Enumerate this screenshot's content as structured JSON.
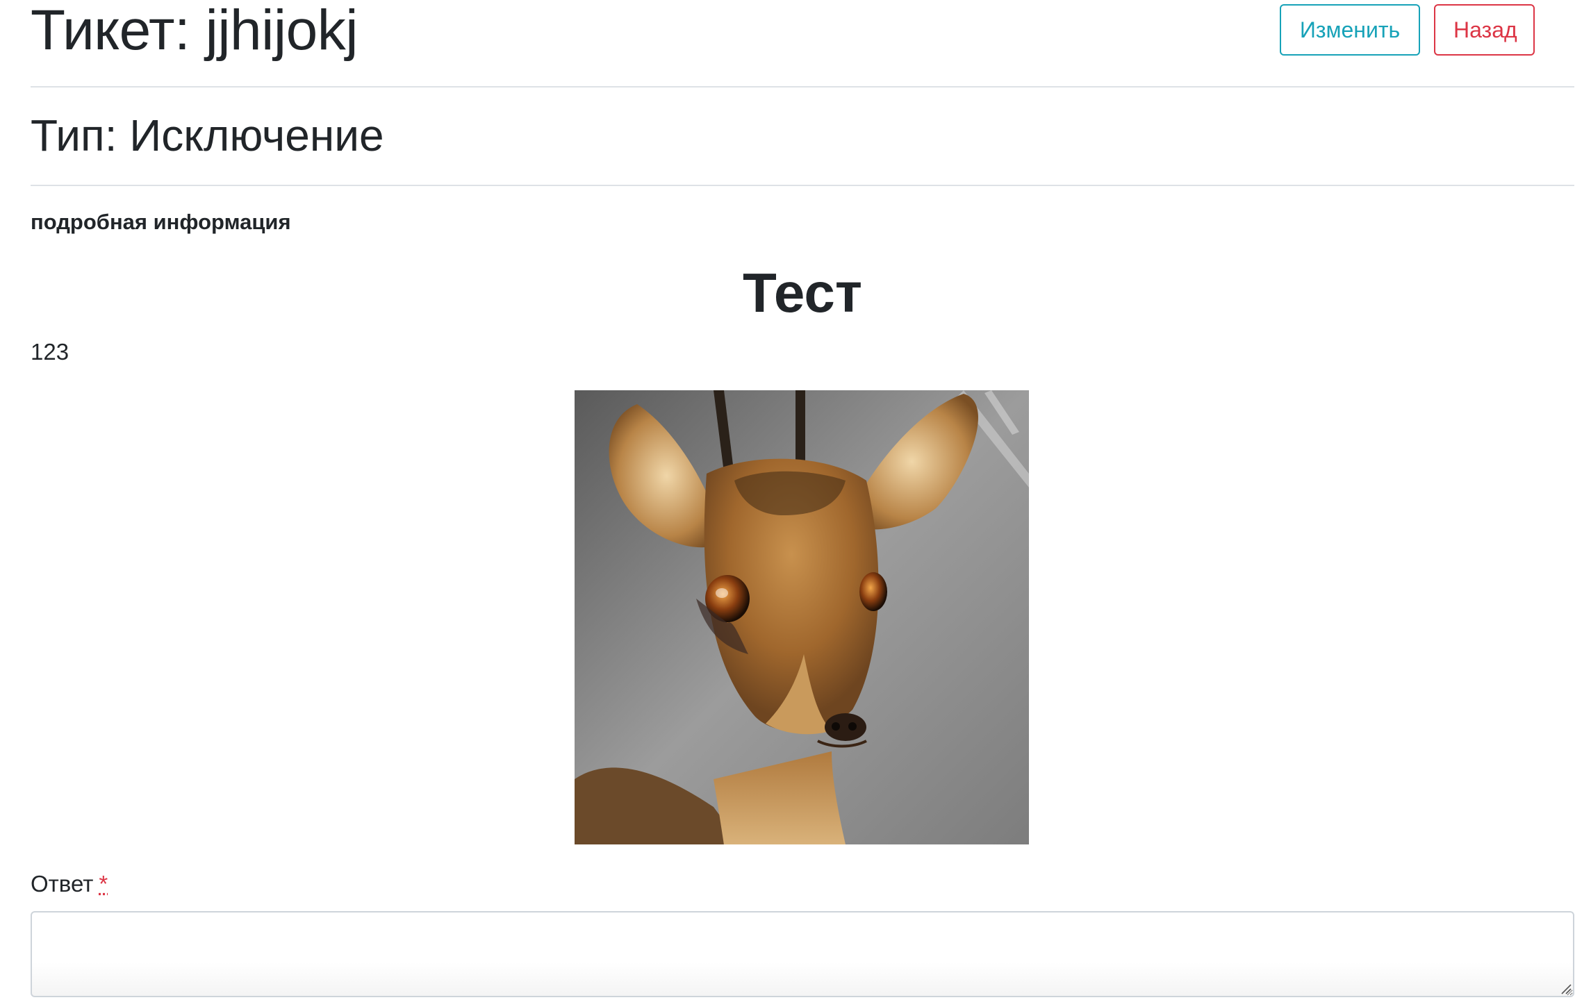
{
  "ticket": {
    "title_prefix": "Тикет:",
    "title_value": "jjhijokj",
    "type_text": "Тип: Исключение"
  },
  "actions": {
    "edit_label": "Изменить",
    "back_label": "Назад",
    "edit_color": "#17a2b8",
    "back_color": "#dc3545"
  },
  "details": {
    "label": "подробная информация",
    "heading": "Тест",
    "body": "123"
  },
  "answer": {
    "label": "Ответ",
    "required_marker": "*",
    "value": ""
  }
}
